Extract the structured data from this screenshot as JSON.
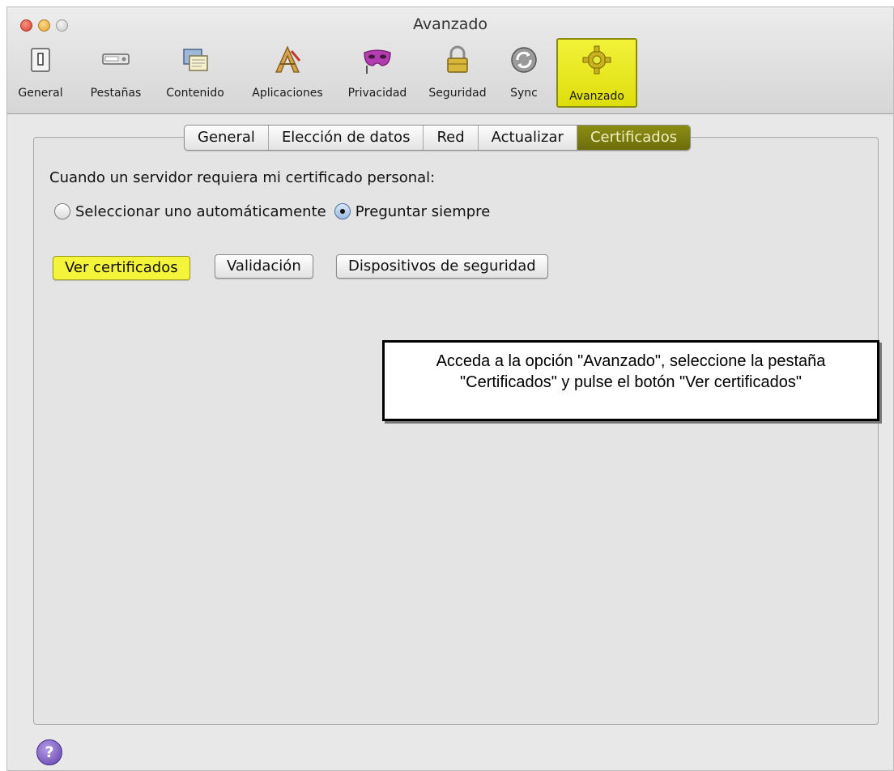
{
  "window": {
    "title": "Avanzado"
  },
  "toolbar": {
    "items": [
      {
        "label": "General",
        "icon": "switch-icon"
      },
      {
        "label": "Pestañas",
        "icon": "tabs-icon"
      },
      {
        "label": "Contenido",
        "icon": "content-icon"
      },
      {
        "label": "Aplicaciones",
        "icon": "applications-icon"
      },
      {
        "label": "Privacidad",
        "icon": "privacy-mask-icon"
      },
      {
        "label": "Seguridad",
        "icon": "padlock-icon"
      },
      {
        "label": "Sync",
        "icon": "sync-icon"
      },
      {
        "label": "Avanzado",
        "icon": "gear-icon",
        "selected": true
      }
    ]
  },
  "tabs": [
    {
      "label": "General"
    },
    {
      "label": "Elección de datos"
    },
    {
      "label": "Red"
    },
    {
      "label": "Actualizar"
    },
    {
      "label": "Certificados",
      "active": true
    }
  ],
  "certificates": {
    "question": "Cuando un servidor requiera mi certificado personal:",
    "option_auto": "Seleccionar uno automáticamente",
    "option_ask": "Preguntar siempre",
    "selected_option": "Preguntar siempre",
    "buttons": {
      "view": "Ver certificados",
      "validation": "Validación",
      "devices": "Dispositivos de seguridad"
    }
  },
  "note": {
    "line1": "Acceda a la opción \"Avanzado\", seleccione la pestaña",
    "line2": "\"Certificados\" y pulse el botón \"Ver certificados\""
  },
  "help": {
    "symbol": "?"
  },
  "colors": {
    "highlight": "#f4f43a",
    "active_tab": "#7b7c10",
    "help": "#6a4bb5"
  }
}
